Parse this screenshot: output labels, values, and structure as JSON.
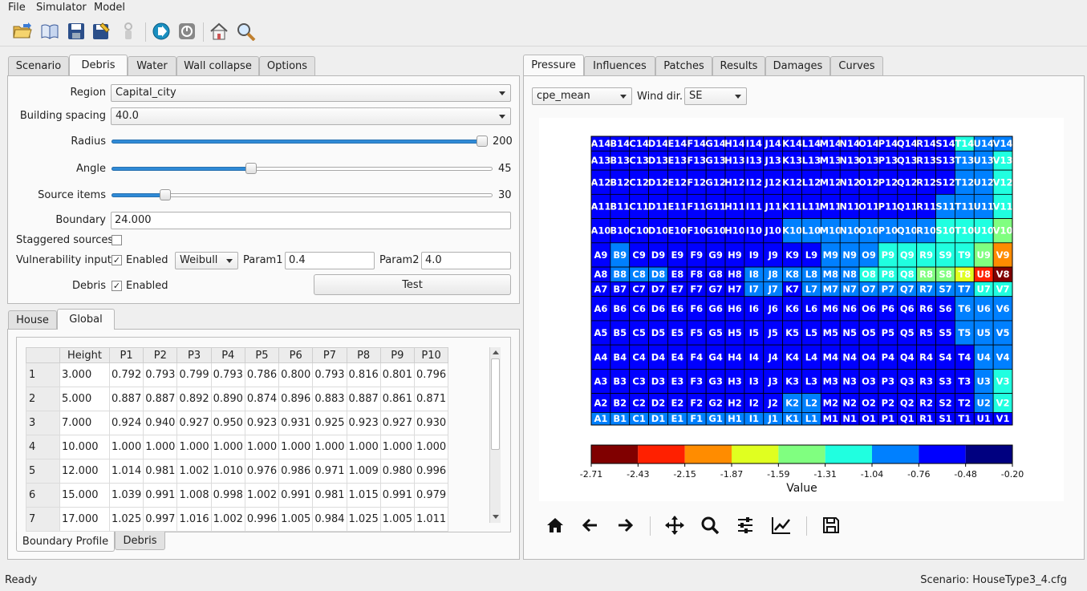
{
  "menu": {
    "file": "File",
    "simulator": "Simulator",
    "model": "Model"
  },
  "toolbar": [
    "open-folder-icon",
    "open-book-icon",
    "save-icon",
    "save-as-icon",
    "stop-icon",
    "run-icon",
    "pause-icon",
    "home-icon",
    "search-icon"
  ],
  "left_tabs": [
    "Scenario",
    "Debris",
    "Water",
    "Wall collapse",
    "Options"
  ],
  "left_active_tab": "Debris",
  "debris": {
    "region_label": "Region",
    "region_value": "Capital_city",
    "spacing_label": "Building spacing",
    "spacing_value": "40.0",
    "radius_label": "Radius",
    "radius_value": "200",
    "radius_fraction": 1.0,
    "angle_label": "Angle",
    "angle_value": "45",
    "angle_fraction": 0.363,
    "source_label": "Source items",
    "source_value": "30",
    "source_fraction": 0.13,
    "boundary_label": "Boundary",
    "boundary_value": "24.000",
    "staggered_label": "Staggered sources",
    "vuln_label": "Vulnerability input",
    "vuln_enabled": "Enabled",
    "vuln_dist": "Weibull",
    "param1_label": "Param1",
    "param1_value": "0.4",
    "param2_label": "Param2",
    "param2_value": "4.0",
    "debris_label": "Debris",
    "debris_enabled": "Enabled",
    "test_button": "Test",
    "check_mark": "✓"
  },
  "lower_tabs": [
    "House",
    "Global"
  ],
  "lower_active_tab": "Global",
  "global_table": {
    "headers": [
      "Height",
      "P1",
      "P2",
      "P3",
      "P4",
      "P5",
      "P6",
      "P7",
      "P8",
      "P9",
      "P10"
    ],
    "rows": [
      {
        "n": "1",
        "height": "3.000",
        "p": [
          "0.792",
          "0.793",
          "0.799",
          "0.793",
          "0.786",
          "0.800",
          "0.793",
          "0.816",
          "0.801",
          "0.796"
        ]
      },
      {
        "n": "2",
        "height": "5.000",
        "p": [
          "0.887",
          "0.887",
          "0.892",
          "0.890",
          "0.874",
          "0.896",
          "0.883",
          "0.887",
          "0.861",
          "0.871"
        ]
      },
      {
        "n": "3",
        "height": "7.000",
        "p": [
          "0.924",
          "0.940",
          "0.927",
          "0.950",
          "0.923",
          "0.931",
          "0.925",
          "0.923",
          "0.927",
          "0.930"
        ]
      },
      {
        "n": "4",
        "height": "10.000",
        "p": [
          "1.000",
          "1.000",
          "1.000",
          "1.000",
          "1.000",
          "1.000",
          "1.000",
          "1.000",
          "1.000",
          "1.000"
        ]
      },
      {
        "n": "5",
        "height": "12.000",
        "p": [
          "1.014",
          "0.981",
          "1.002",
          "1.010",
          "0.976",
          "0.986",
          "0.971",
          "1.009",
          "0.980",
          "0.996"
        ]
      },
      {
        "n": "6",
        "height": "15.000",
        "p": [
          "1.039",
          "0.991",
          "1.008",
          "0.998",
          "1.002",
          "0.991",
          "0.981",
          "1.015",
          "0.991",
          "0.979"
        ]
      },
      {
        "n": "7",
        "height": "17.000",
        "p": [
          "1.025",
          "0.997",
          "1.016",
          "1.002",
          "0.996",
          "1.005",
          "0.984",
          "1.025",
          "1.005",
          "1.011"
        ]
      }
    ]
  },
  "bottom_tabs": [
    "Boundary Profile",
    "Debris"
  ],
  "bottom_active_tab": "Boundary Profile",
  "right_tabs": [
    "Pressure",
    "Influences",
    "Patches",
    "Results",
    "Damages",
    "Curves"
  ],
  "right_active_tab": "Pressure",
  "pressure": {
    "stat_value": "cpe_mean",
    "wind_label": "Wind dir.",
    "wind_value": "SE"
  },
  "chart_data": {
    "type": "heatmap",
    "columns": [
      "A",
      "B",
      "C",
      "D",
      "E",
      "F",
      "G",
      "H",
      "I",
      "J",
      "K",
      "L",
      "M",
      "N",
      "O",
      "P",
      "Q",
      "R",
      "S",
      "T",
      "U",
      "V"
    ],
    "rows": [
      14,
      13,
      12,
      11,
      10,
      9,
      8,
      7,
      6,
      5,
      4,
      3,
      2,
      1
    ],
    "row_weights": [
      1,
      1.3,
      1.65,
      1.65,
      1.65,
      1.65,
      1,
      1,
      1.65,
      1.65,
      1.65,
      1.65,
      1.3,
      0.85
    ],
    "colorbar_bounds": [
      -2.71,
      -2.43,
      -2.15,
      -1.87,
      -1.59,
      -1.31,
      -1.04,
      -0.76,
      -0.48,
      -0.2
    ],
    "colorbar_labels": [
      "-2.71",
      "-2.43",
      "-2.15",
      "-1.87",
      "-1.59",
      "-1.31",
      "-1.04",
      "-0.76",
      "-0.48",
      "-0.20"
    ],
    "colorbar_colors": [
      "#800000",
      "#ff2000",
      "#ff8c00",
      "#e0ff20",
      "#80ff80",
      "#20ffe0",
      "#0080ff",
      "#0000ff",
      "#000080"
    ],
    "colorbar_label": "Value",
    "bin_grid": [
      "7777777777777777777566",
      "7777777777777777777665",
      "7777777777777777777665",
      "7777777777777777776665",
      "7777777777666666665554",
      "7677777777776665555542",
      "7666777766666655544310",
      "7777777766766666666655",
      "7777777777777777777666",
      "7777777777777777777666",
      "7777777777777777777766",
      "7777777777777777777765",
      "7777777777667777777765",
      "6666666666667777777777"
    ]
  },
  "plot_toolbar": [
    "home-icon",
    "back-arrow-icon",
    "forward-arrow-icon",
    "pan-icon",
    "zoom-icon",
    "configure-icon",
    "edit-curve-icon",
    "save-figure-icon"
  ],
  "status": {
    "left": "Ready",
    "right": "Scenario: HouseType3_4.cfg"
  }
}
